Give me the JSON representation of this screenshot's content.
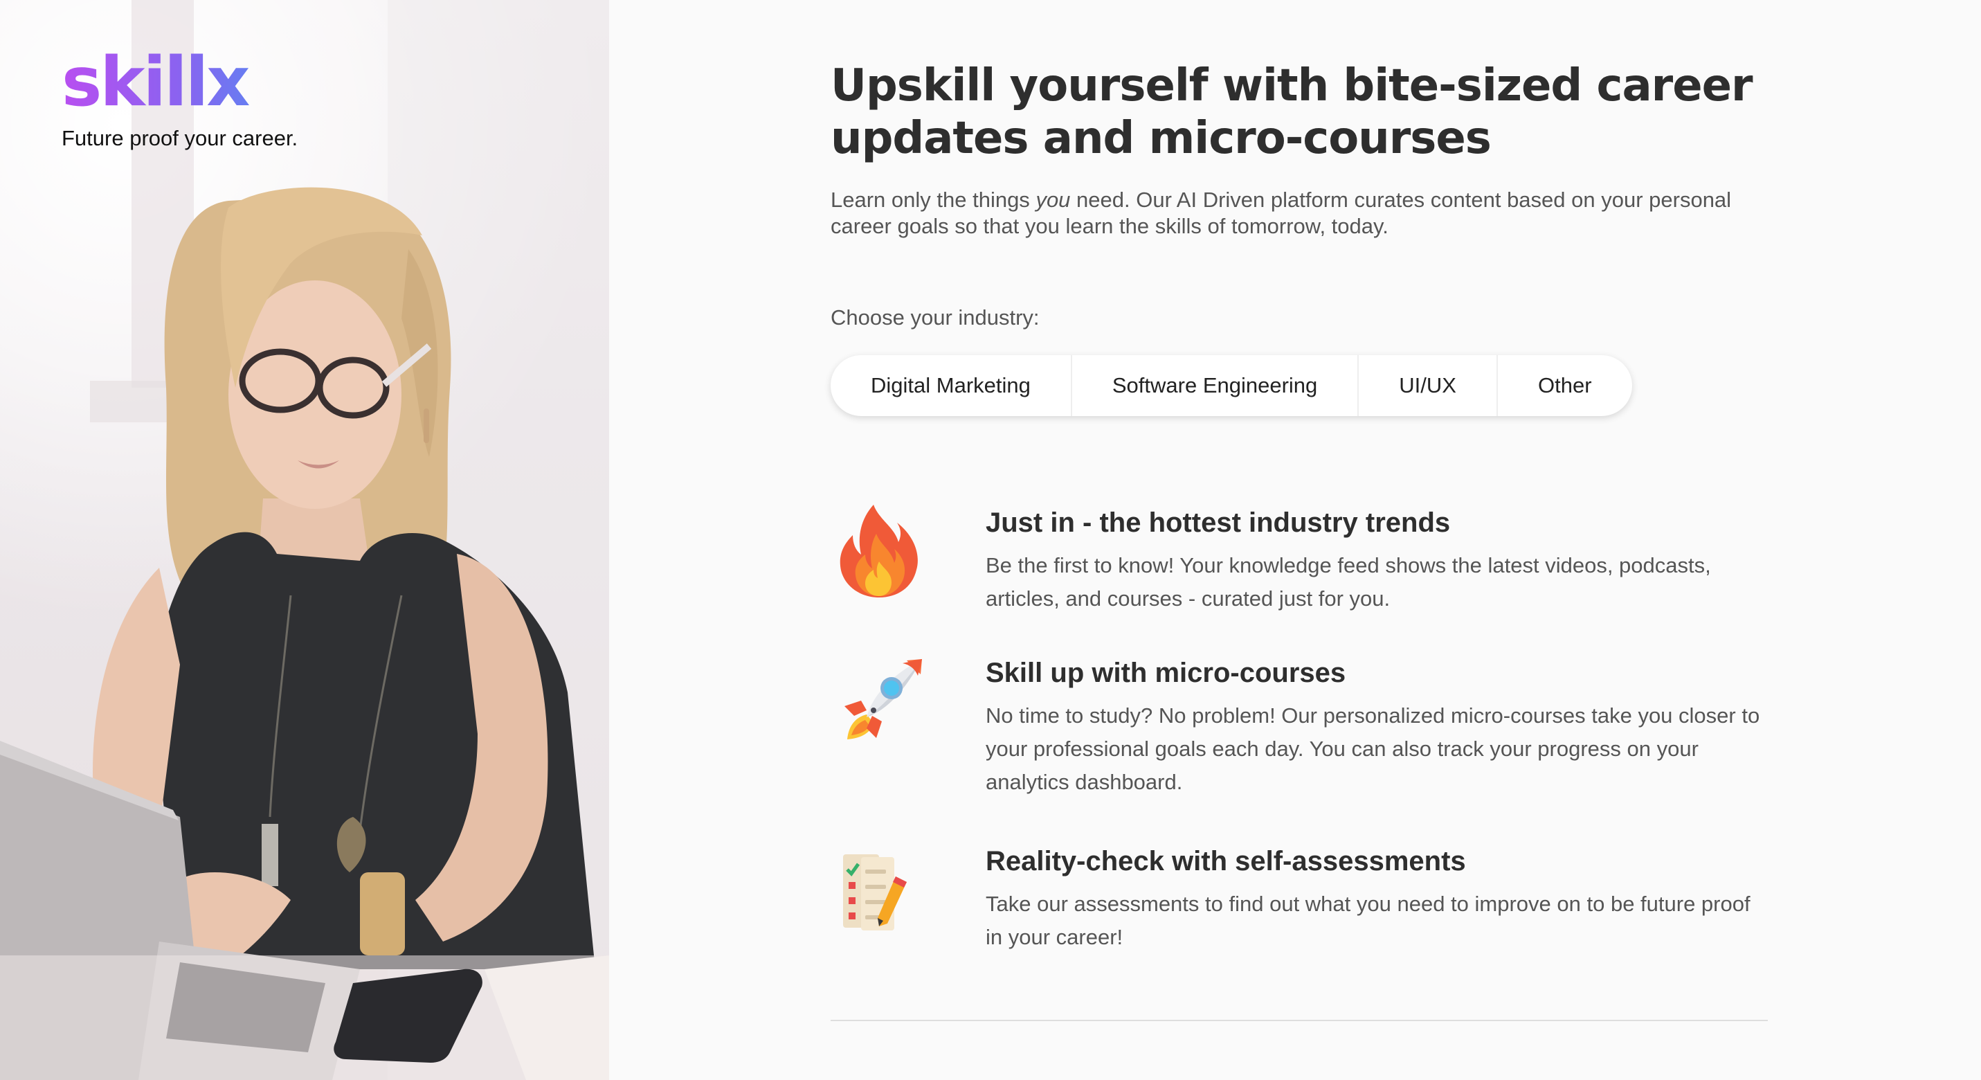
{
  "brand": {
    "logo_text": "skillx",
    "tagline": "Future proof your career.",
    "logo_gradient": [
      "#b84ff0",
      "#4f8ff2"
    ]
  },
  "hero": {
    "headline": "Upskill yourself with bite-sized career updates and micro-courses",
    "subline_before": "Learn only the things ",
    "subline_emphasis": "you",
    "subline_after": " need. Our AI Driven platform curates content based on your personal career goals so that you learn the skills of tomorrow, today."
  },
  "industry": {
    "label": "Choose your industry:",
    "options": [
      "Digital Marketing",
      "Software Engineering",
      "UI/UX",
      "Other"
    ]
  },
  "features": [
    {
      "icon": "fire-icon",
      "title": "Just in - the hottest industry trends",
      "description": "Be the first to know! Your knowledge feed shows the latest videos, podcasts, articles, and courses - curated just for you."
    },
    {
      "icon": "rocket-icon",
      "title": "Skill up with micro-courses",
      "description": "No time to study? No problem! Our personalized micro-courses take you closer to your professional goals each day. You can also track your progress on your analytics dashboard."
    },
    {
      "icon": "checklist-icon",
      "title": "Reality-check with self-assessments",
      "description": "Take our assessments to find out what you need to improve on to be future proof in your career!"
    }
  ],
  "colors": {
    "background": "#fafafa",
    "heading": "#2e2e2e",
    "body_text": "#555555"
  }
}
